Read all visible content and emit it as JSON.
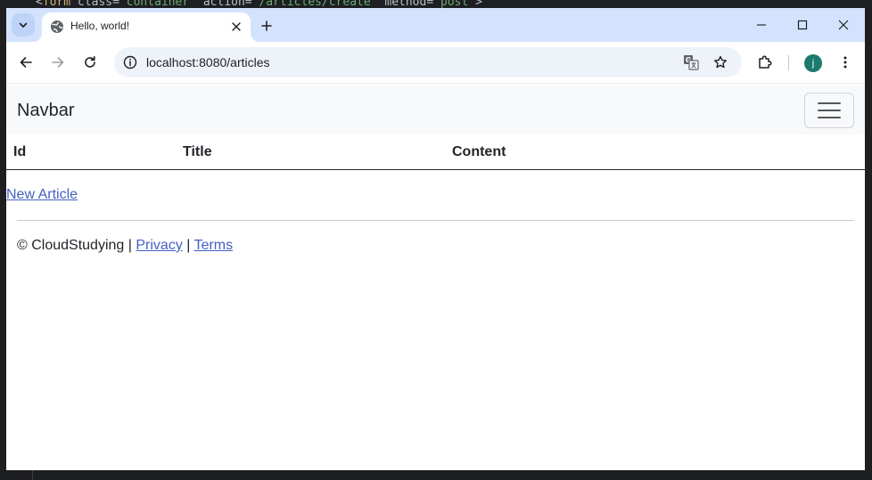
{
  "editor_bg": {
    "code_line_prefix": "<",
    "code_tag": "form",
    "code_attr1": " class=",
    "code_val1": "\"container\"",
    "code_attr2": " action=",
    "code_val2": "\"/articles/create\"",
    "code_attr3": " method=",
    "code_val3": "\"post\"",
    "code_suffix": ">"
  },
  "browser": {
    "tab": {
      "title": "Hello, world!"
    },
    "address": {
      "url": "localhost:8080/articles"
    },
    "profile_initial": "j",
    "accent_color": "#d3e3fd"
  },
  "page": {
    "navbar": {
      "brand": "Navbar"
    },
    "table": {
      "headers": [
        "Id",
        "Title",
        "Content"
      ],
      "rows": []
    },
    "new_article_link": "New Article",
    "footer": {
      "copyright": "© CloudStudying | ",
      "separator": " | ",
      "privacy": "Privacy",
      "terms": "Terms"
    }
  }
}
